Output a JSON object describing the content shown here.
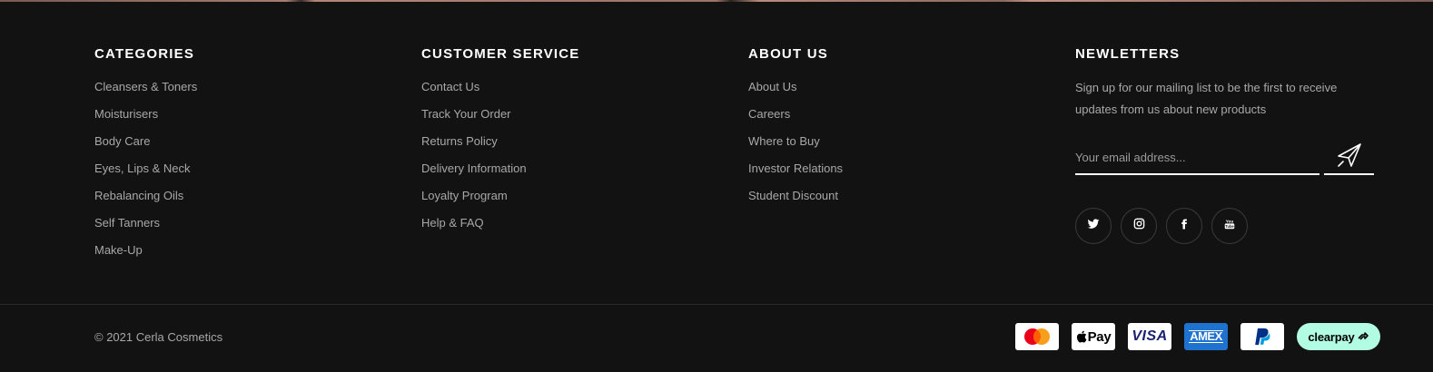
{
  "columns": {
    "categories": {
      "title": "CATEGORIES",
      "links": [
        "Cleansers & Toners",
        "Moisturisers",
        "Body Care",
        "Eyes, Lips & Neck",
        "Rebalancing Oils",
        "Self Tanners",
        "Make-Up"
      ]
    },
    "customer_service": {
      "title": "CUSTOMER SERVICE",
      "links": [
        "Contact Us",
        "Track Your Order",
        "Returns Policy",
        "Delivery Information",
        "Loyalty Program",
        "Help & FAQ"
      ]
    },
    "about_us": {
      "title": "ABOUT US",
      "links": [
        "About Us",
        "Careers",
        "Where to Buy",
        "Investor Relations",
        "Student Discount"
      ]
    },
    "newsletters": {
      "title": "NEWLETTERS",
      "text": "Sign up for our mailing list to be the first to receive updates from us about new products",
      "email_placeholder": "Your email address...",
      "send_icon": "paper-plane-icon"
    }
  },
  "socials": [
    "twitter-icon",
    "instagram-icon",
    "facebook-icon",
    "youtube-icon"
  ],
  "bottom": {
    "copyright": "© 2021 Cerla Cosmetics",
    "payments": {
      "mastercard": "mastercard-logo",
      "applepay": "Pay",
      "visa": "VISA",
      "amex": "AMEX",
      "paypal": "paypal-logo",
      "clearpay": "clearpay"
    }
  },
  "colors": {
    "background": "#121212",
    "heading": "#ffffff",
    "link": "#a8a8a8",
    "clearpay_mint": "#b2fce4",
    "amex_blue": "#1f72cd"
  }
}
